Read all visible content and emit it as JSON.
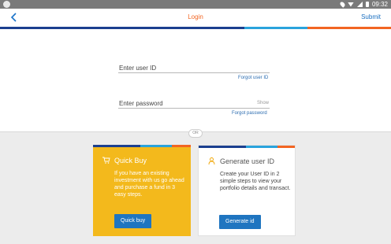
{
  "status_bar": {
    "time": "09:32",
    "icons": [
      "location-icon",
      "wifi-icon",
      "signal-icon",
      "battery-icon"
    ]
  },
  "header": {
    "back_icon": "chevron-left-icon",
    "title": "Login",
    "submit_label": "Submit"
  },
  "colors": {
    "accent_blue": "#1f75c0",
    "brand_orange": "#f26522",
    "quick_card": "#f3b91c",
    "stripe_navy": "#1b3f8f",
    "stripe_sky": "#2aa3dc"
  },
  "form": {
    "user_id_placeholder": "Enter user ID",
    "forgot_user_id": "Forgot user ID",
    "password_placeholder": "Enter password",
    "show_label": "Show",
    "forgot_password": "Forgot password"
  },
  "divider": {
    "label": "OR"
  },
  "quick_buy": {
    "icon": "cart-icon",
    "title": "Quick Buy",
    "description": "If you have an existing investment with us go ahead and purchase a fund in 3 easy steps.",
    "button_label": "Quick buy"
  },
  "generate_id": {
    "icon": "user-icon",
    "title": "Generate user ID",
    "description": "Create your User ID in 2 simple steps to view your portfolio details and transact.",
    "button_label": "Generate id"
  }
}
